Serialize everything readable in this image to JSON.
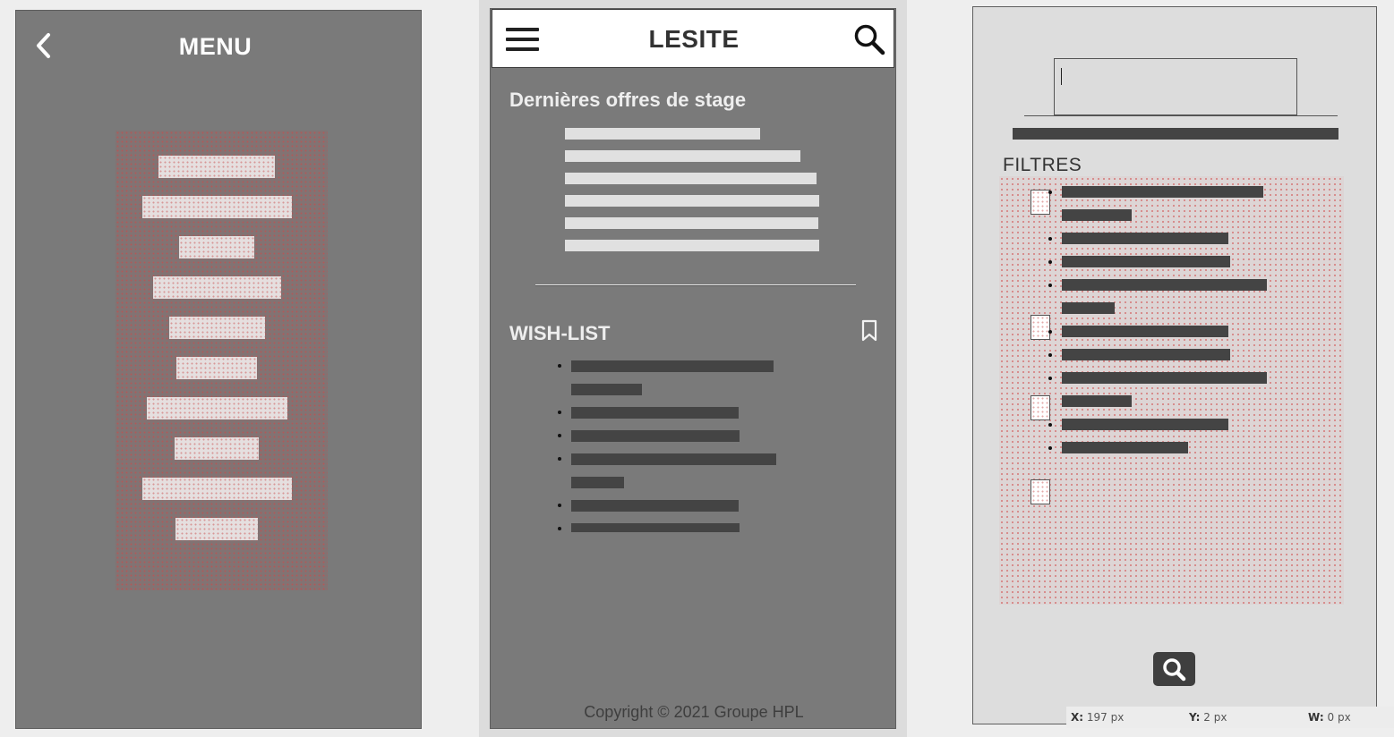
{
  "menu_panel": {
    "title": "MENU",
    "icons": {
      "back": "chevron-left-icon"
    },
    "items_count_shown": 10
  },
  "home_panel": {
    "site_title": "LESITE",
    "icons": {
      "menu": "hamburger-icon",
      "search": "search-icon",
      "wishlist": "bookmark-icon"
    },
    "latest_offers_heading": "Dernières offres de stage",
    "wishlist_heading": "WISH-LIST",
    "copyright": "Copyright © 2021 Groupe HPL"
  },
  "search_panel": {
    "filters_heading": "FILTRES",
    "icons": {
      "submit": "search-icon"
    }
  },
  "status_bar": {
    "x_label": "X:",
    "x_value": "197 px",
    "y_label": "Y:",
    "y_value": "2 px",
    "w_label": "W:",
    "w_value": "0 px"
  }
}
